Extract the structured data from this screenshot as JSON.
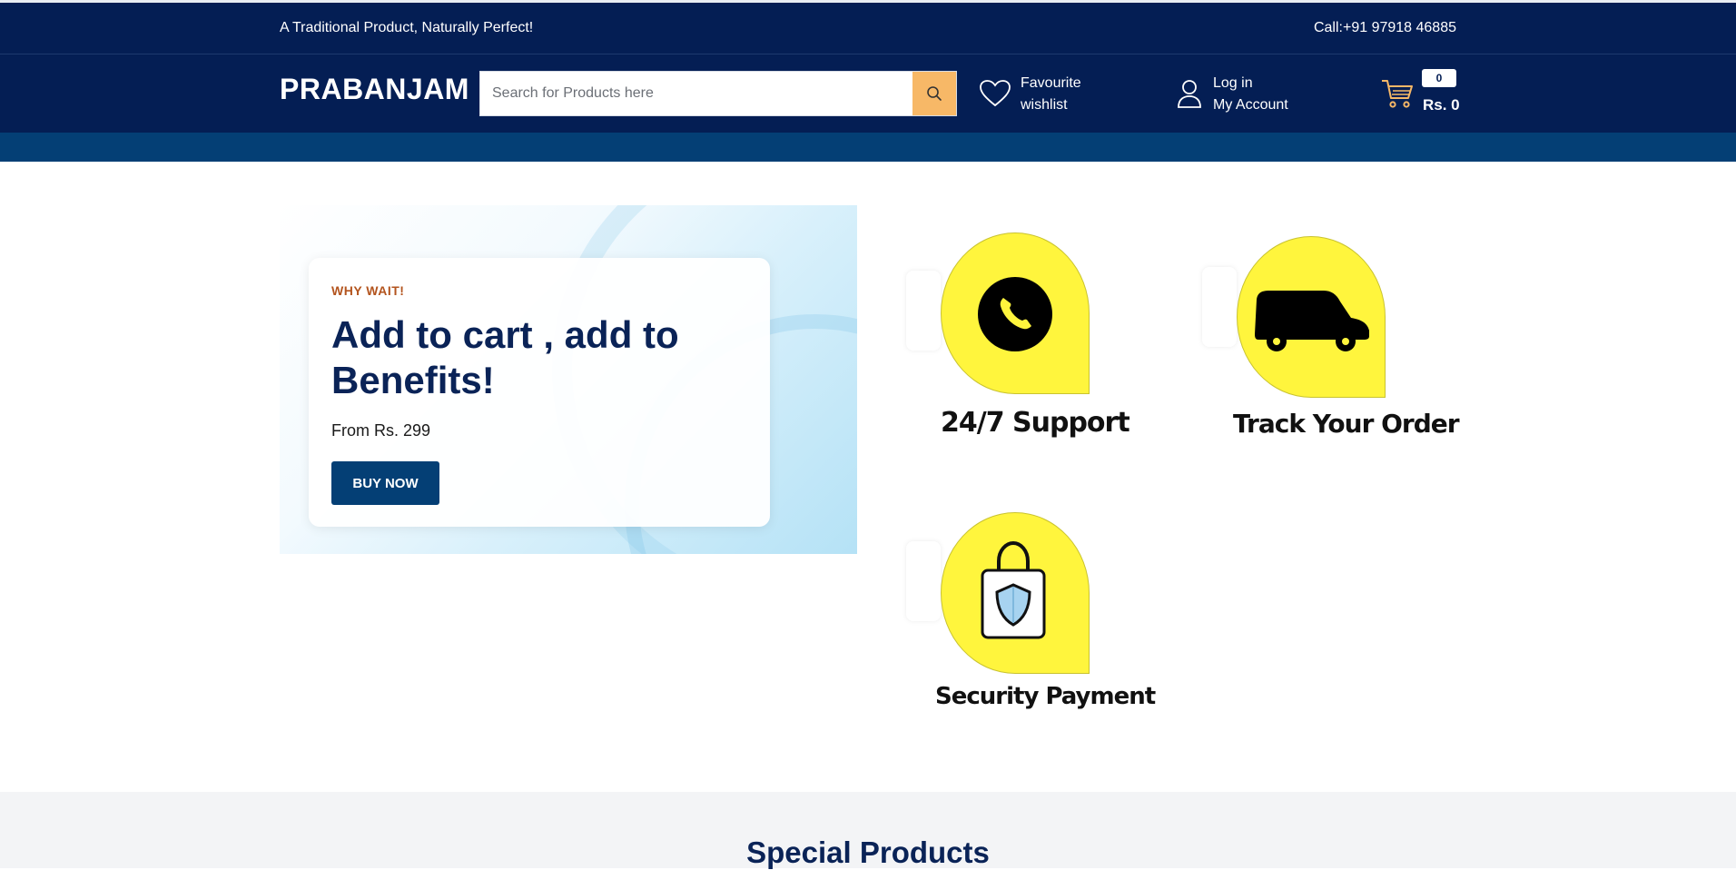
{
  "topbar": {
    "tagline": "A Traditional Product, Naturally Perfect!",
    "phone": "Call:+91 97918 46885"
  },
  "header": {
    "logo": "PRABANJAM",
    "search_placeholder": "Search for Products here",
    "wishlist_line1": "Favourite",
    "wishlist_line2": "wishlist",
    "account_line1": "Log in",
    "account_line2": "My Account",
    "cart_count": "0",
    "cart_total": "Rs. 0"
  },
  "promo": {
    "eyebrow": "WHY WAIT!",
    "title": "Add to cart , add to Benefits!",
    "price": "From Rs. 299",
    "button": "BUY NOW"
  },
  "features": [
    {
      "label": "24/7 Support",
      "icon": "phone-icon"
    },
    {
      "label": "Track Your Order",
      "icon": "truck-icon"
    },
    {
      "label": "Security Payment",
      "icon": "shopping-bag-shield-icon"
    }
  ],
  "sections": {
    "special_title": "Special Products"
  },
  "colors": {
    "header_bg": "#041e54",
    "nav_strip": "#043f75",
    "search_button": "#f7b867",
    "feature_yellow": "#fff53d",
    "eyebrow": "#b3541e"
  }
}
